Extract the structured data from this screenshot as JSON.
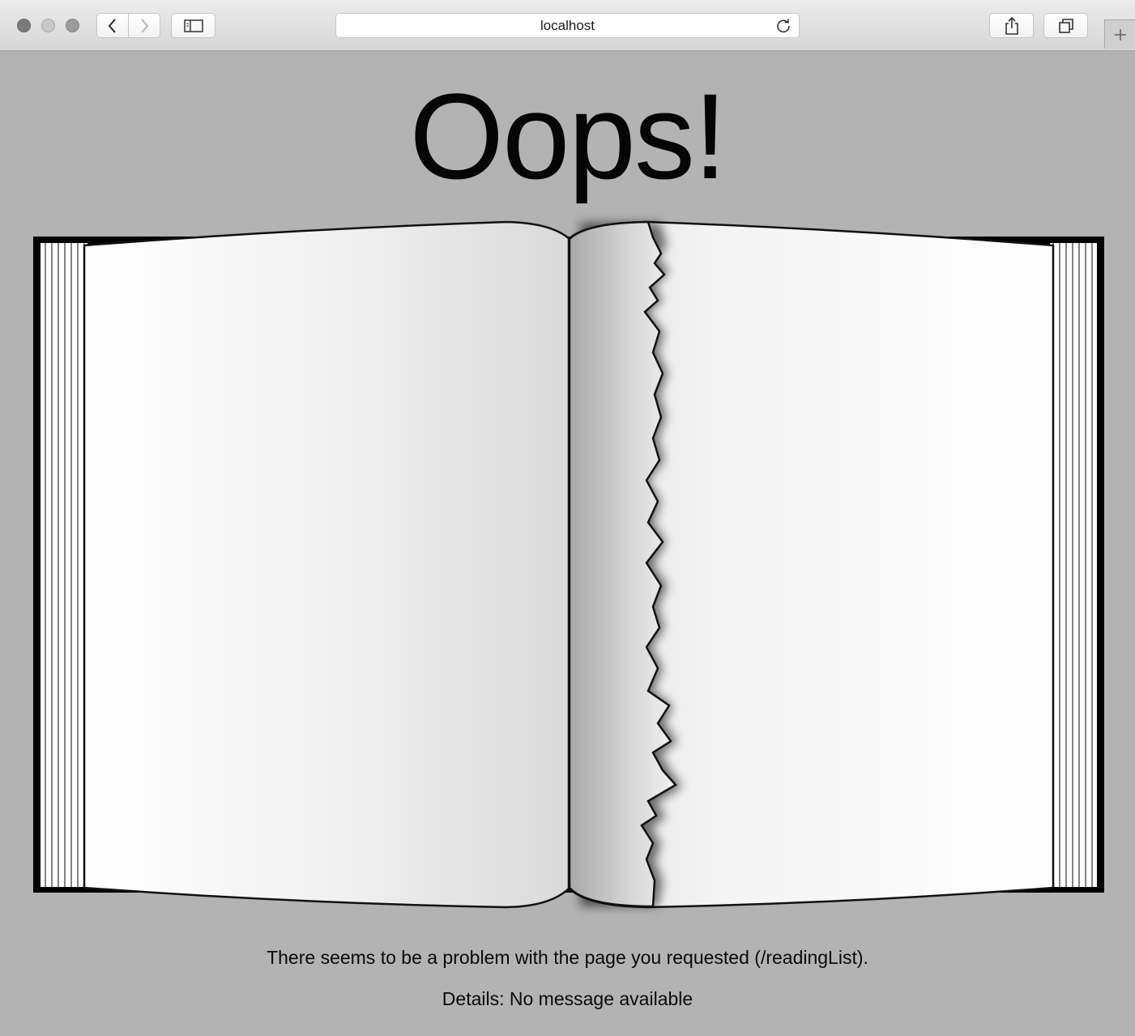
{
  "browser": {
    "address": "localhost",
    "icons": {
      "back": "chevron-left-icon",
      "forward": "chevron-right-icon",
      "sidebar": "sidebar-icon",
      "reload": "reload-icon",
      "share": "share-icon",
      "tabs": "tabs-icon",
      "new_tab": "plus-icon"
    }
  },
  "page": {
    "title": "Oops!",
    "message": "There seems to be a problem with the page you requested (/readingList).",
    "details": "Details: No message available",
    "illustration": "torn-book-illustration"
  }
}
